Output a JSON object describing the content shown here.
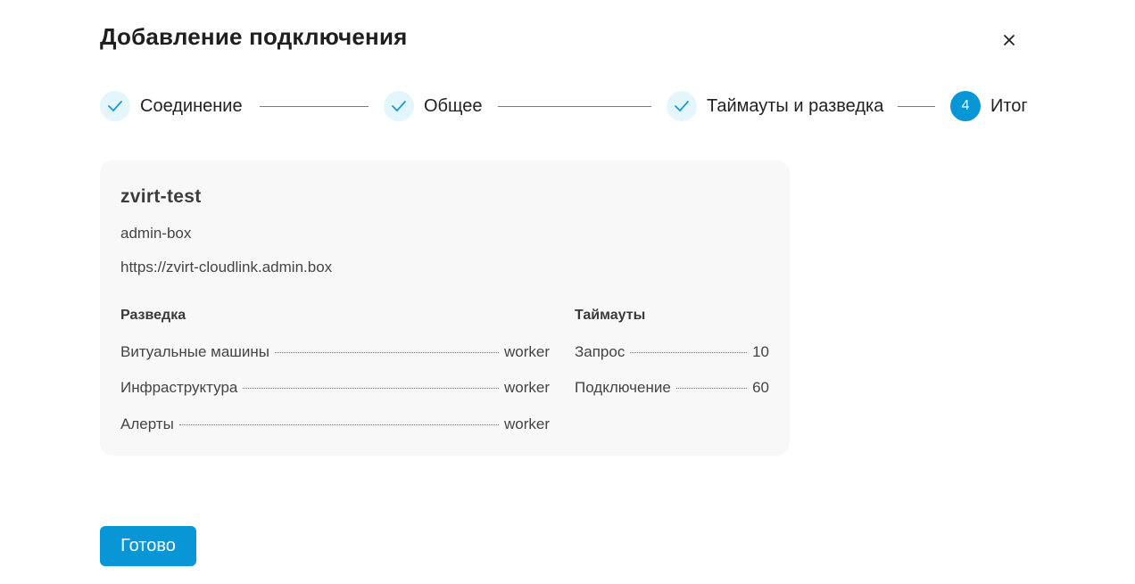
{
  "dialog": {
    "title": "Добавление подключения",
    "close_icon": "close-icon"
  },
  "stepper": {
    "steps": [
      {
        "label": "Соединение",
        "state": "done",
        "icon": "check-icon"
      },
      {
        "label": "Общее",
        "state": "done",
        "icon": "check-icon"
      },
      {
        "label": "Таймауты и разведка",
        "state": "done",
        "icon": "check-icon"
      },
      {
        "label": "Итог",
        "state": "active",
        "number": "4"
      }
    ],
    "accent_color": "#0996d6",
    "done_bg_color": "#e3f6fc"
  },
  "summary": {
    "name": "zvirt-test",
    "host": "admin-box",
    "url": "https://zvirt-cloudlink.admin.box",
    "discovery": {
      "title": "Разведка",
      "rows": [
        {
          "label": "Витуальные машины",
          "value": "worker"
        },
        {
          "label": "Инфраструктура",
          "value": "worker"
        },
        {
          "label": "Алерты",
          "value": "worker"
        }
      ]
    },
    "timeouts": {
      "title": "Таймауты",
      "rows": [
        {
          "label": "Запрос",
          "value": "10"
        },
        {
          "label": "Подключение",
          "value": "60"
        }
      ]
    }
  },
  "footer": {
    "done_label": "Готово"
  }
}
